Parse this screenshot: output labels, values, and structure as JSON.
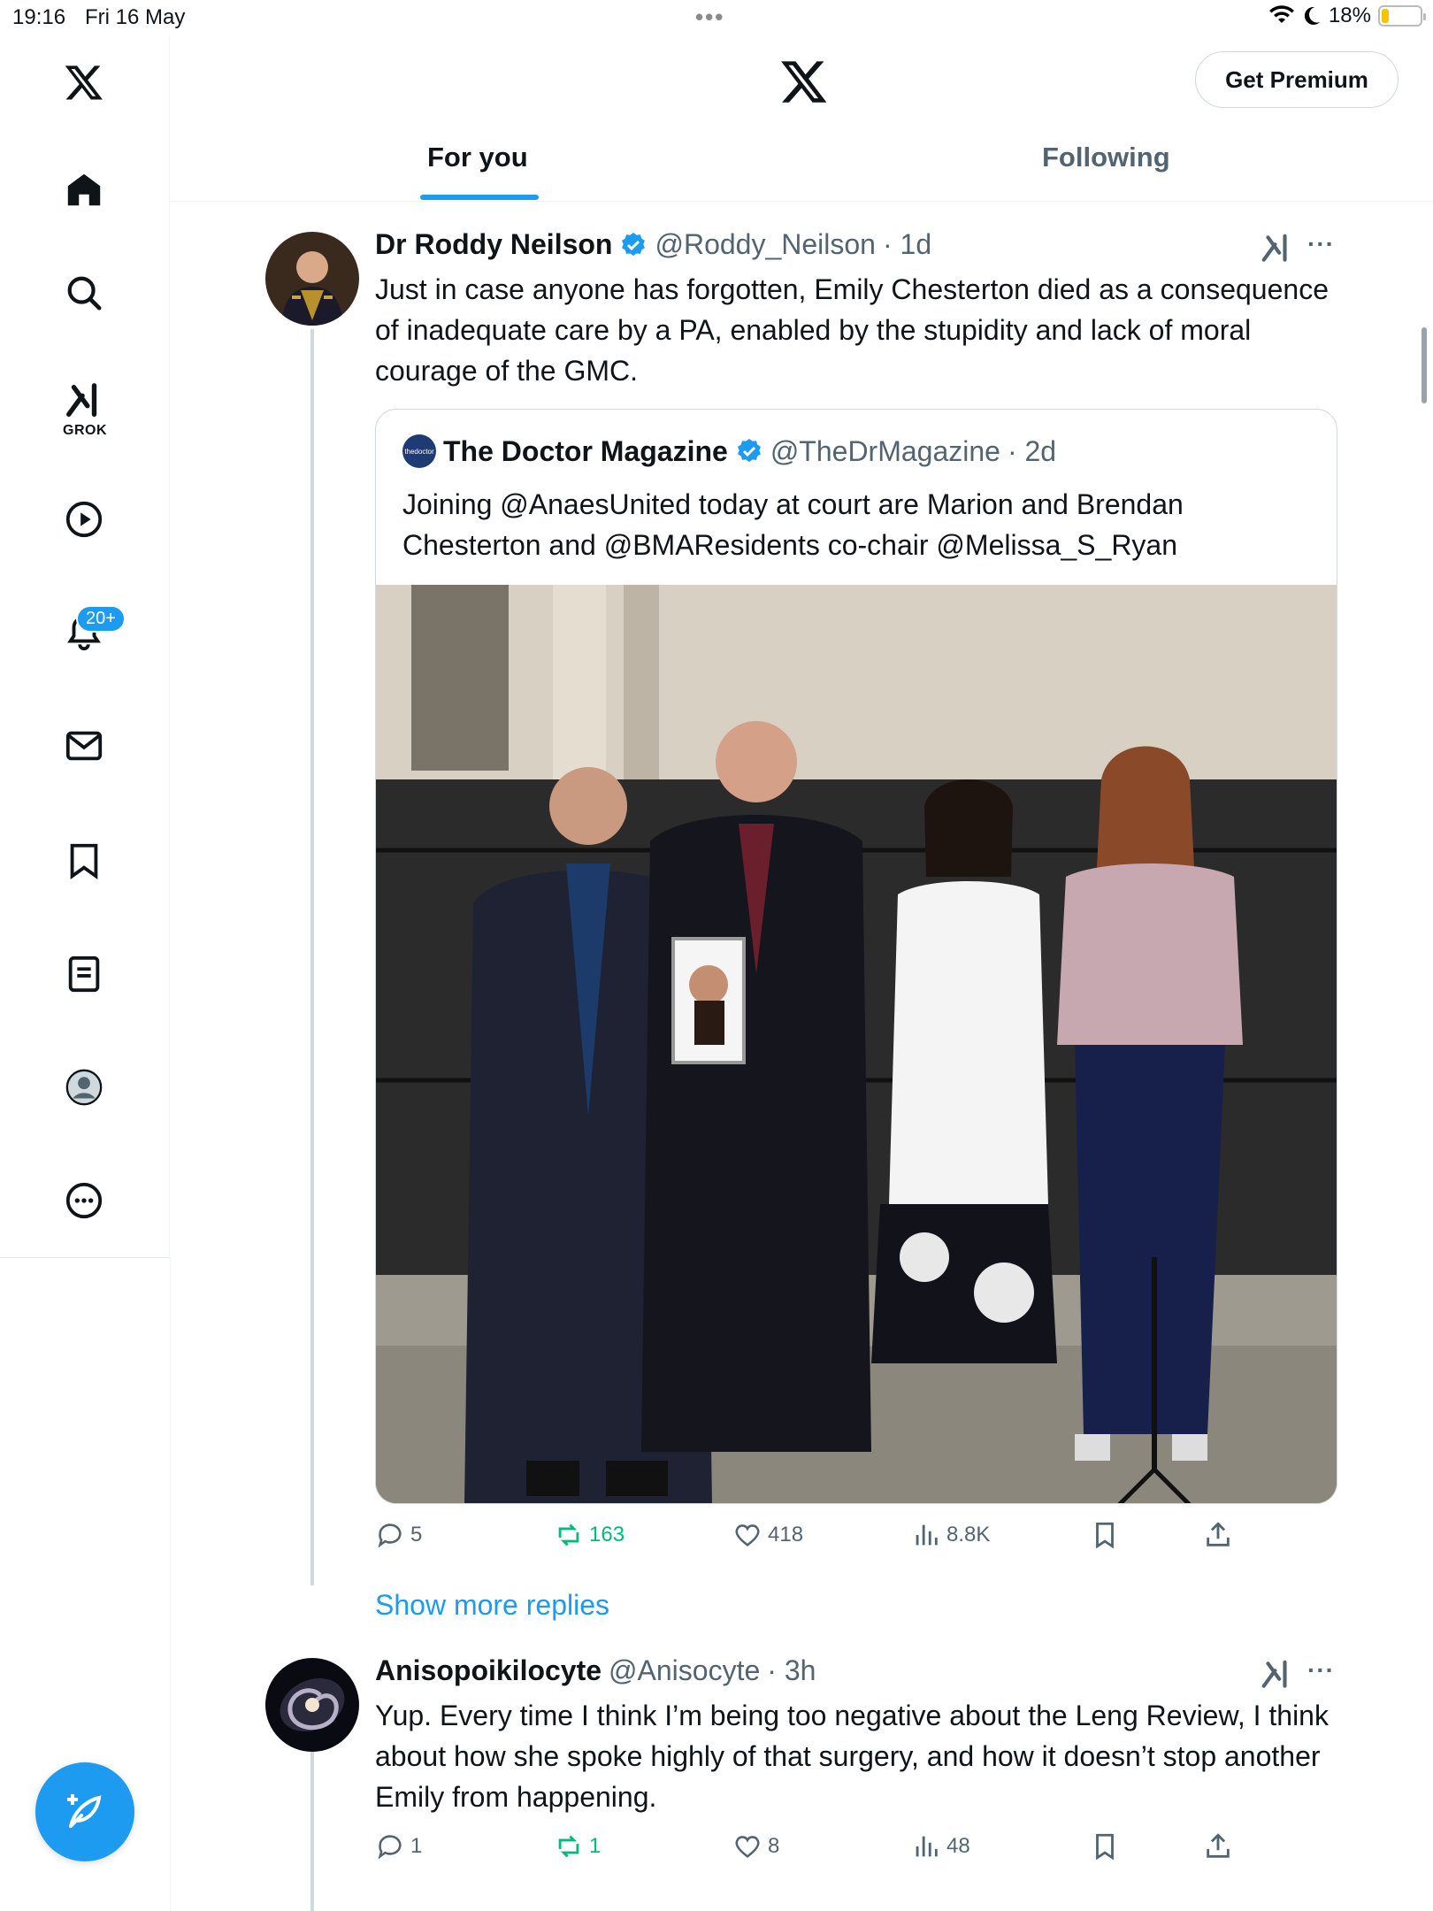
{
  "status_bar": {
    "time": "19:16",
    "date": "Fri 16 May",
    "battery_percent": "18%",
    "battery_level": 0.18
  },
  "left_nav": {
    "grok_label": "GROK",
    "notifications_badge": "20+",
    "icons": [
      "x-logo-icon",
      "home-icon",
      "search-icon",
      "grok-icon",
      "video-icon",
      "bell-icon",
      "mail-icon",
      "bookmark-icon",
      "list-icon",
      "profile-icon",
      "more-icon"
    ]
  },
  "header": {
    "premium_label": "Get Premium",
    "tabs": [
      {
        "label": "For you",
        "active": true
      },
      {
        "label": "Following",
        "active": false
      }
    ]
  },
  "tweet1": {
    "name": "Dr Roddy Neilson",
    "handle": "@Roddy_Neilson",
    "time": "· 1d",
    "more": "···",
    "text": "Just in case anyone has forgotten, Emily Chesterton died as a consequence of inadequate care by a PA, enabled by the stupidity and lack of moral courage of the GMC.",
    "quote": {
      "avatar_text": "thedoctor",
      "name": "The Doctor Magazine",
      "handle": "@TheDrMagazine",
      "time": "· 2d",
      "text": "Joining @AnaesUnited today at court are Marion and Brendan Chesterton and @BMAResidents co-chair @Melissa_S_Ryan"
    },
    "actions": {
      "replies": "5",
      "reposts": "163",
      "likes": "418",
      "views": "8.8K"
    }
  },
  "show_more": "Show more replies",
  "tweet2": {
    "name": "Anisopoikilocyte",
    "handle": "@Anisocyte",
    "time": "· 3h",
    "more": "···",
    "text": "Yup. Every time I think I’m being too negative about the Leng Review, I think about how she spoke highly of that surgery, and how it doesn’t stop another Emily from happening.",
    "actions": {
      "replies": "1",
      "reposts": "1",
      "likes": "8",
      "views": "48"
    }
  },
  "colors": {
    "accent": "#1d9bf0",
    "repost": "#00ba7c",
    "muted": "#536471"
  }
}
